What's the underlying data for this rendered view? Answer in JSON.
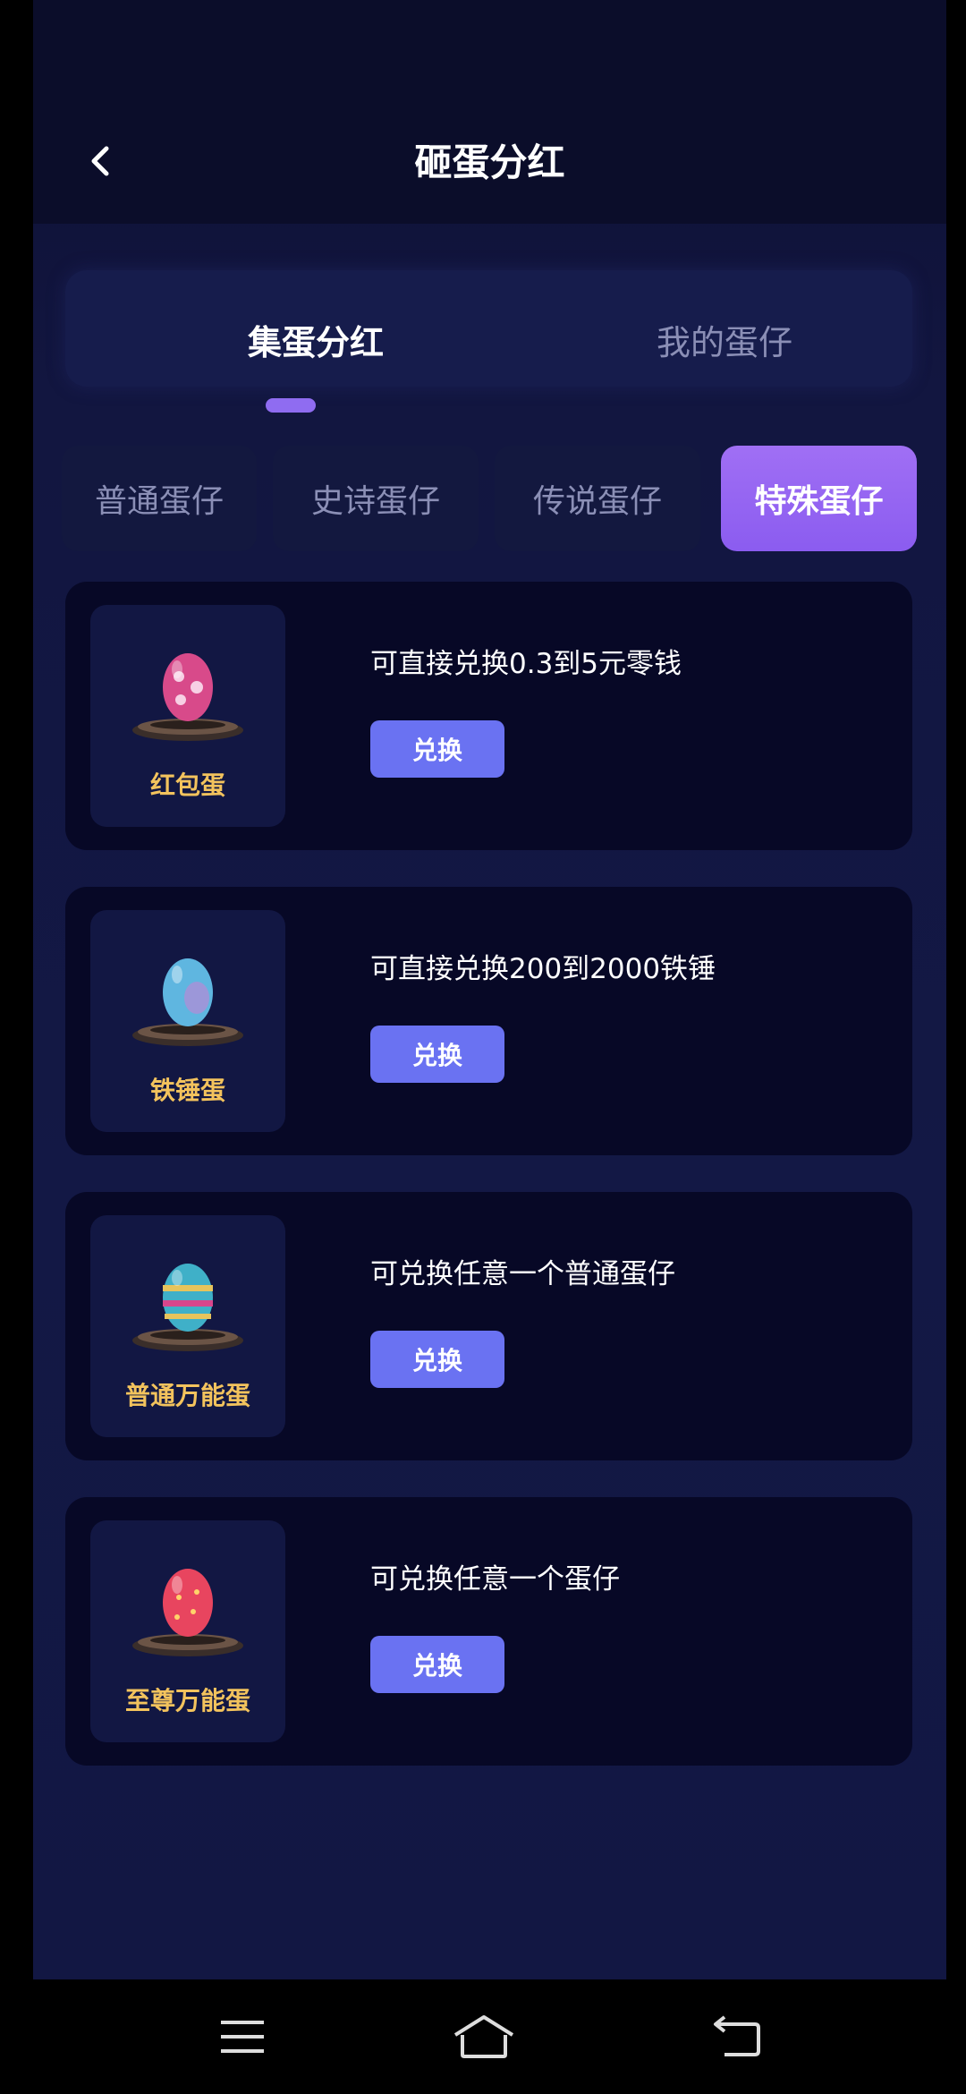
{
  "header": {
    "title": "砸蛋分红",
    "back_icon": "chevron-left-icon"
  },
  "main_tabs": [
    {
      "label": "集蛋分红",
      "active": true
    },
    {
      "label": "我的蛋仔",
      "active": false
    }
  ],
  "category_tabs": [
    {
      "label": "普通蛋仔",
      "active": false
    },
    {
      "label": "史诗蛋仔",
      "active": false
    },
    {
      "label": "传说蛋仔",
      "active": false
    },
    {
      "label": "特殊蛋仔",
      "active": true
    }
  ],
  "items": [
    {
      "name": "红包蛋",
      "description": "可直接兑换0.3到5元零钱",
      "button": "兑换",
      "egg_icon": "red-envelope-egg-icon",
      "egg_color": "#d84a8a"
    },
    {
      "name": "铁锤蛋",
      "description": "可直接兑换200到2000铁锤",
      "button": "兑换",
      "egg_icon": "hammer-egg-icon",
      "egg_color": "#5fb6e0"
    },
    {
      "name": "普通万能蛋",
      "description": "可兑换任意一个普通蛋仔",
      "button": "兑换",
      "egg_icon": "common-wildcard-egg-icon",
      "egg_color": "#3fb0c8"
    },
    {
      "name": "至尊万能蛋",
      "description": "可兑换任意一个蛋仔",
      "button": "兑换",
      "egg_icon": "supreme-wildcard-egg-icon",
      "egg_color": "#e8455f"
    }
  ],
  "colors": {
    "accent": "#8f6cf1",
    "button": "#6a72f2",
    "egg_label": "#f3c35d"
  },
  "navbar": {
    "icons": [
      "menu-icon",
      "home-icon",
      "back-icon"
    ]
  }
}
